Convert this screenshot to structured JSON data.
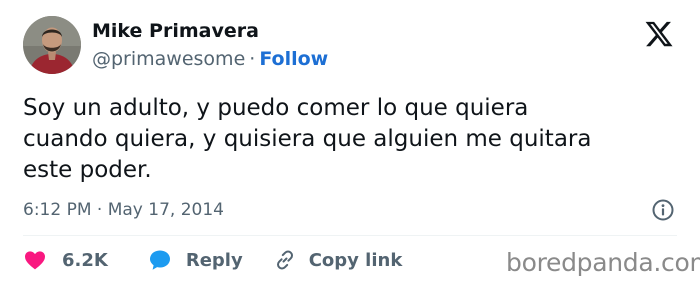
{
  "author": {
    "name": "Mike Primavera",
    "handle": "@primawesome",
    "separator": "·",
    "follow_label": "Follow"
  },
  "tweet": {
    "text": "Soy un adulto, y puedo comer lo que quiera\ncuando quiera, y quisiera que alguien me quitara\neste poder.",
    "time": "6:12 PM · May 17, 2014"
  },
  "actions": {
    "likes_count": "6.2K",
    "reply_label": "Reply",
    "copy_link_label": "Copy link"
  },
  "icons": {
    "platform": "x-logo-icon",
    "info": "info-icon",
    "like": "heart-icon",
    "reply": "speech-bubble-icon",
    "copy_link": "link-icon"
  },
  "colors": {
    "text": "#0f1419",
    "secondary": "#536471",
    "follow": "#1d6fd4",
    "heart": "#f91880",
    "reply": "#1d9bf0",
    "watermark": "#8a8a8a"
  },
  "watermark": "boredpanda.com"
}
